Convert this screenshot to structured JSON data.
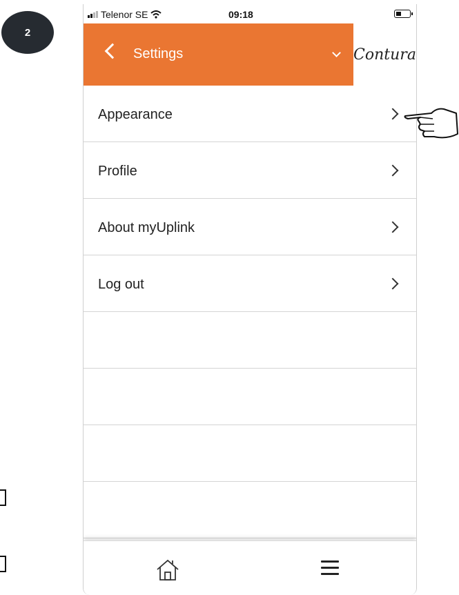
{
  "step_number": "2",
  "status_bar": {
    "carrier": "Telenor SE",
    "time": "09:18"
  },
  "header": {
    "title": "Settings",
    "brand": "Contura",
    "background_color": "#ea7632"
  },
  "menu_items": [
    {
      "label": "Appearance"
    },
    {
      "label": "Profile"
    },
    {
      "label": "About myUplink"
    },
    {
      "label": "Log out"
    }
  ],
  "empty_rows": 4,
  "icons": {
    "back": "chevron-left-icon",
    "dropdown": "chevron-down-icon",
    "row": "chevron-right-icon",
    "home": "home-icon",
    "menu": "hamburger-menu-icon",
    "pointer": "pointing-hand-icon"
  }
}
